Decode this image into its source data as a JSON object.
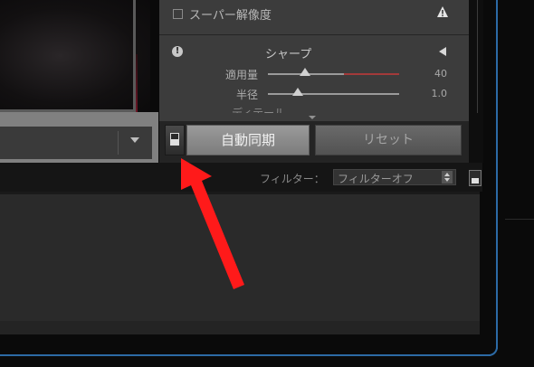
{
  "develop_panel": {
    "super_resolution_label": "スーパー解像度",
    "sharpen": {
      "title": "シャープ",
      "amount": {
        "label": "適用量",
        "value": "40"
      },
      "radius": {
        "label": "半径",
        "value": "1.0"
      },
      "next_row_partial": "ディテール"
    }
  },
  "buttons": {
    "auto_sync": "自動同期",
    "reset": "リセット"
  },
  "filter_bar": {
    "label": "フィルター：",
    "selected": "フィルターオフ"
  },
  "icons": [
    "warning-icon",
    "alert-icon",
    "collapse-icon",
    "dropdown-arrow-icon",
    "sync-toggle-icon",
    "spinner-icon",
    "filmstrip-toggle-icon"
  ],
  "colors": {
    "panel_bg": "#3c3c3c",
    "window_outline": "#2c6aa5",
    "annotation_arrow": "#ff1a1a"
  }
}
